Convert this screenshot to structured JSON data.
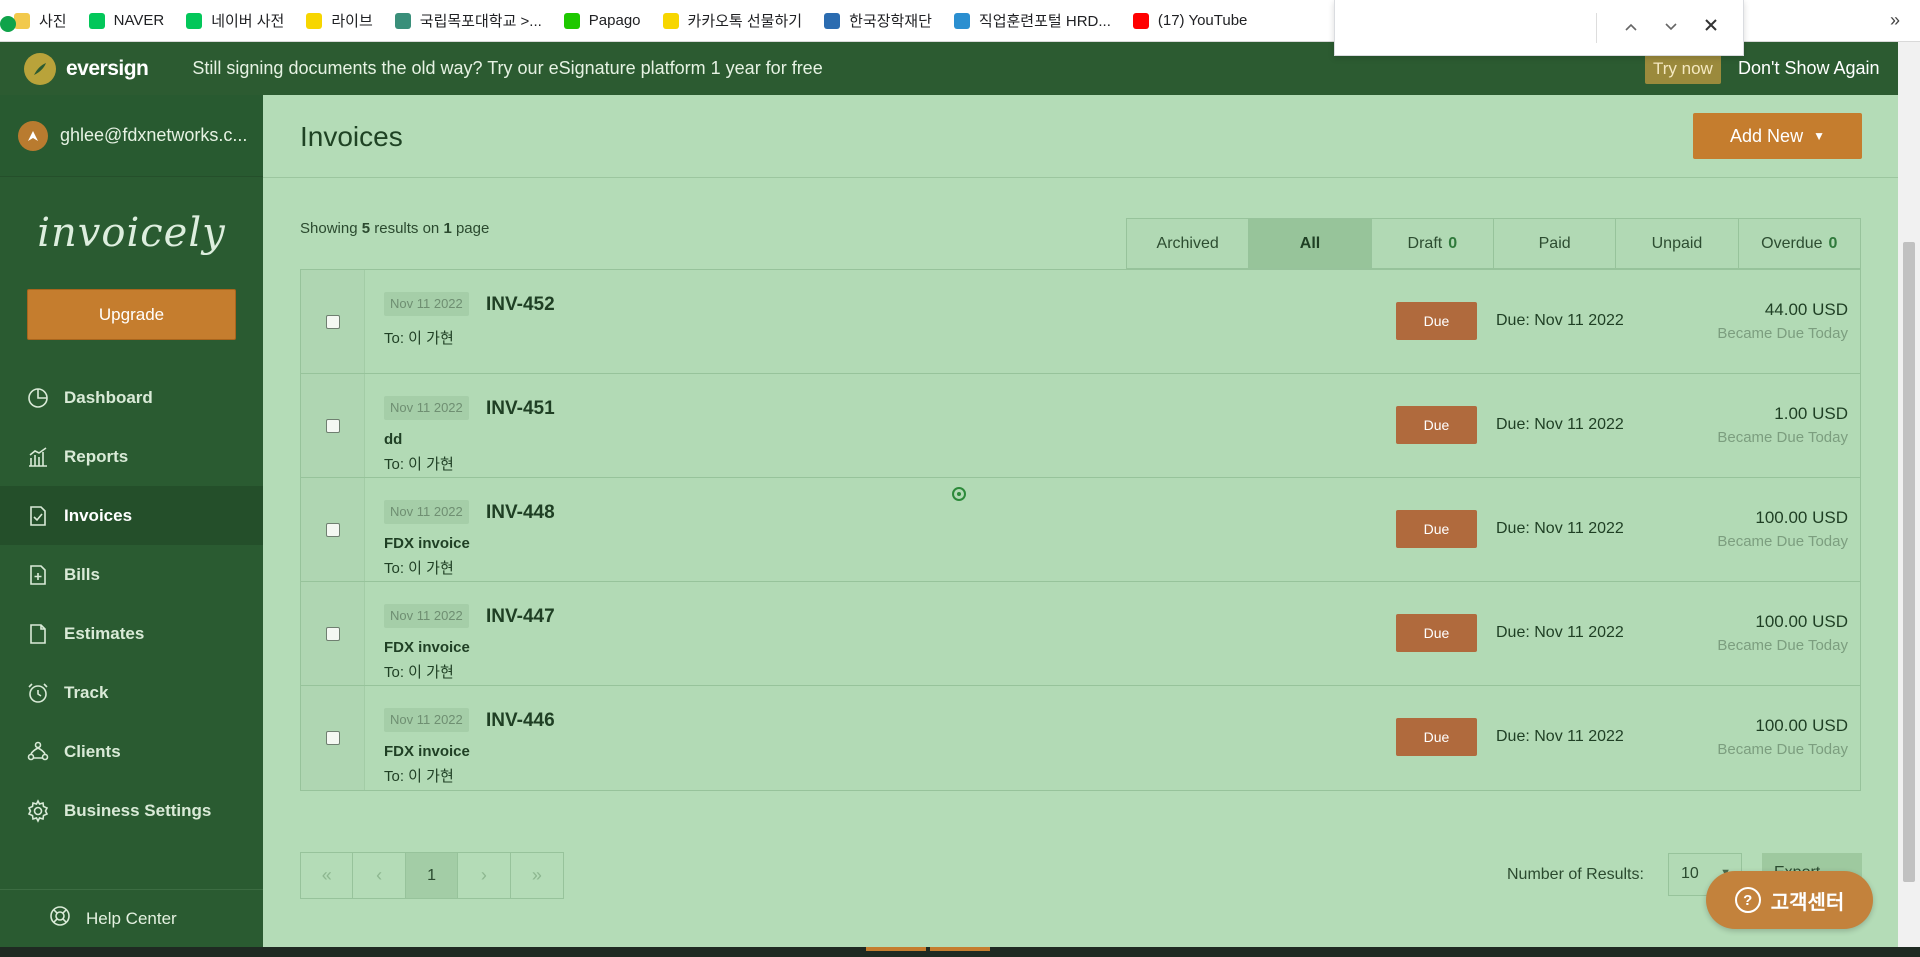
{
  "bookmarks": [
    {
      "label": "사진",
      "icon": "folder-icon",
      "color": "#f2c94c"
    },
    {
      "label": "NAVER",
      "icon": "naver-icon",
      "color": "#03c75a"
    },
    {
      "label": "네이버 사전",
      "icon": "naver-dictionary-icon",
      "color": "#03c75a"
    },
    {
      "label": "라이브",
      "icon": "kakao-live-icon",
      "color": "#f7d600"
    },
    {
      "label": "국립목포대학교 >...",
      "icon": "university-icon",
      "color": "#3a8f7a"
    },
    {
      "label": "Papago",
      "icon": "papago-icon",
      "color": "#1ec800"
    },
    {
      "label": "카카오톡 선물하기",
      "icon": "kakao-gift-icon",
      "color": "#f7d600"
    },
    {
      "label": "한국장학재단",
      "icon": "scholarship-icon",
      "color": "#2b6cb0"
    },
    {
      "label": "직업훈련포털 HRD...",
      "icon": "hrd-icon",
      "color": "#2b8fd0"
    },
    {
      "label": "(17) YouTube",
      "icon": "youtube-icon",
      "color": "#ff0000"
    }
  ],
  "bookmarks_more": "»",
  "banner": {
    "brand": "eversign",
    "text": "Still signing documents the old way? Try our eSignature platform 1 year for free",
    "try_now": "Try now",
    "dont_show": "Don't Show Again"
  },
  "sidebar": {
    "user_email": "ghlee@fdxnetworks.c...",
    "brand": "invoicely",
    "upgrade": "Upgrade",
    "items": [
      {
        "label": "Dashboard",
        "icon": "pie-chart-icon"
      },
      {
        "label": "Reports",
        "icon": "bar-chart-icon"
      },
      {
        "label": "Invoices",
        "icon": "invoice-document-icon"
      },
      {
        "label": "Bills",
        "icon": "bill-document-icon"
      },
      {
        "label": "Estimates",
        "icon": "estimate-document-icon"
      },
      {
        "label": "Track",
        "icon": "alarm-clock-icon"
      },
      {
        "label": "Clients",
        "icon": "clients-icon"
      },
      {
        "label": "Business Settings",
        "icon": "gear-icon"
      }
    ],
    "active": "Invoices",
    "help": "Help Center"
  },
  "header": {
    "title": "Invoices",
    "add_new": "Add New"
  },
  "summary": {
    "prefix": "Showing",
    "count": "5",
    "middle": "results on",
    "pages": "1",
    "suffix": "page"
  },
  "filters": [
    {
      "label": "Archived",
      "count": ""
    },
    {
      "label": "All",
      "count": ""
    },
    {
      "label": "Draft",
      "count": "0"
    },
    {
      "label": "Paid",
      "count": ""
    },
    {
      "label": "Unpaid",
      "count": ""
    },
    {
      "label": "Overdue",
      "count": "0"
    }
  ],
  "active_filter": "All",
  "invoices": [
    {
      "date": "Nov 11 2022",
      "number": "INV-452",
      "description": "",
      "to": "To: 이 가현",
      "status": "Due",
      "due": "Due: Nov 11 2022",
      "amount": "44.00 USD",
      "note": "Became Due Today"
    },
    {
      "date": "Nov 11 2022",
      "number": "INV-451",
      "description": "dd",
      "to": "To: 이 가현",
      "status": "Due",
      "due": "Due: Nov 11 2022",
      "amount": "1.00 USD",
      "note": "Became Due Today"
    },
    {
      "date": "Nov 11 2022",
      "number": "INV-448",
      "description": "FDX invoice",
      "to": "To: 이 가현",
      "status": "Due",
      "due": "Due: Nov 11 2022",
      "amount": "100.00 USD",
      "note": "Became Due Today"
    },
    {
      "date": "Nov 11 2022",
      "number": "INV-447",
      "description": "FDX invoice",
      "to": "To: 이 가현",
      "status": "Due",
      "due": "Due: Nov 11 2022",
      "amount": "100.00 USD",
      "note": "Became Due Today"
    },
    {
      "date": "Nov 11 2022",
      "number": "INV-446",
      "description": "FDX invoice",
      "to": "To: 이 가현",
      "status": "Due",
      "due": "Due: Nov 11 2022",
      "amount": "100.00 USD",
      "note": "Became Due Today"
    }
  ],
  "pagination": {
    "first": "«",
    "prev": "‹",
    "current": "1",
    "next": "›",
    "last": "»"
  },
  "results": {
    "label": "Number of Results:",
    "value": "10",
    "export": "Export"
  },
  "help_chat": {
    "label": "고객센터",
    "symbol": "?"
  },
  "colors": {
    "accent": "#c57d2e",
    "sidebar": "#2a5b31",
    "main_bg": "#b4dcb7",
    "due_badge": "#b06a3d"
  }
}
